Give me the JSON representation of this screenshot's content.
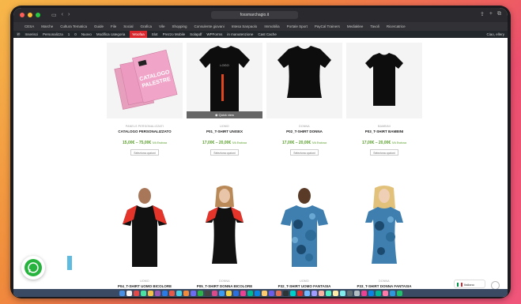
{
  "browser": {
    "url": "fossmarchagio.it",
    "traffic_lights": [
      "#ff5f57",
      "#febc2e",
      "#28c840"
    ]
  },
  "bookmarks": [
    "CESA",
    "Marche",
    "Cultura Tematica",
    "Guide",
    "File",
    "Social",
    "Grafica",
    "Vile",
    "Shopping",
    "Consulente giovani",
    "Intesa Sanpaolo",
    "Immobilia",
    "Portale Sport",
    "PayCal Trainers",
    "Mediaklee",
    "Tavoli",
    "Ricercatrice"
  ],
  "adminbar": {
    "items": [
      "Inserisci",
      "Personalizza",
      "1",
      "0",
      "Nuovo",
      "Modifica categoria",
      "Woofaa",
      "Slot",
      "Prezzo Mobile",
      "Solapdf",
      "WPForms",
      "in manutenzione",
      "Cast Cache"
    ],
    "highlight_index": 6,
    "greeting": "Ciao, ellery"
  },
  "products": [
    {
      "category": "PANELS PERSONALIZZATI",
      "name": "CATALOGO PERSONALIZZATO",
      "price": "15,00€ – 75,00€",
      "price_suffix": "IVA Esclusa",
      "button": "Seleziona opzioni",
      "catalog_top": "CATALOGO",
      "catalog_bottom": "PALESTRE"
    },
    {
      "category": "UOMO",
      "name": "P01_T-SHIRT UNISEX",
      "price": "17,00€ – 20,00€",
      "price_suffix": "IVA Esclusa",
      "button": "Seleziona opzioni",
      "quick_view": "Quick view",
      "print_text": "HAPPY",
      "shirt_text": "LOGO"
    },
    {
      "category": "DONNA",
      "name": "P02_T-SHIRT DONNA",
      "price": "17,00€ – 20,00€",
      "price_suffix": "IVA Esclusa",
      "button": "Seleziona opzioni"
    },
    {
      "category": "BAMBINI",
      "name": "P03_T-SHIRT BAMBINI",
      "price": "17,00€ – 20,00€",
      "price_suffix": "IVA Esclusa",
      "button": "Seleziona opzioni"
    },
    {
      "category": "UOMO",
      "name": "P04_T-SHIRT UOMO BICOLORE"
    },
    {
      "category": "DONNA",
      "name": "P05_T-SHIRT DONNA BICOLORE"
    },
    {
      "category": "UOMO",
      "name": "P32_T-SHIRT UOMO FANTASIA CAMOUFLAGE"
    },
    {
      "category": "DONNA",
      "name": "P33_T-SHIRT DONNA FANTASIA CAMOUFLAGE"
    }
  ],
  "language": "Italiano",
  "colors": {
    "price": "#5aa02c",
    "admin_highlight": "#d9272e",
    "whatsapp": "#27b43e"
  },
  "dock_colors": [
    "#4a90e2",
    "#f4f4f4",
    "#e24a4a",
    "#4ae2a0",
    "#f2c14a",
    "#9b59b6",
    "#2c7be5",
    "#e25a4a",
    "#4ad0e2",
    "#f08a3c",
    "#6c6cf0",
    "#2bb34a",
    "#444",
    "#d94a8a",
    "#3c9cf0",
    "#f0d34a",
    "#2a6fdb",
    "#e84393",
    "#00b894",
    "#0984e3",
    "#fdcb6e",
    "#6c5ce7",
    "#e17055",
    "#2d3436",
    "#00cec9",
    "#d63031",
    "#74b9ff",
    "#a29bfe",
    "#fab1a0",
    "#55efc4",
    "#ffeaa7",
    "#81ecec",
    "#636e72",
    "#b2bec3",
    "#e84393",
    "#0984e3",
    "#00b894",
    "#fd79a8",
    "#2d98da",
    "#20bf6b"
  ]
}
